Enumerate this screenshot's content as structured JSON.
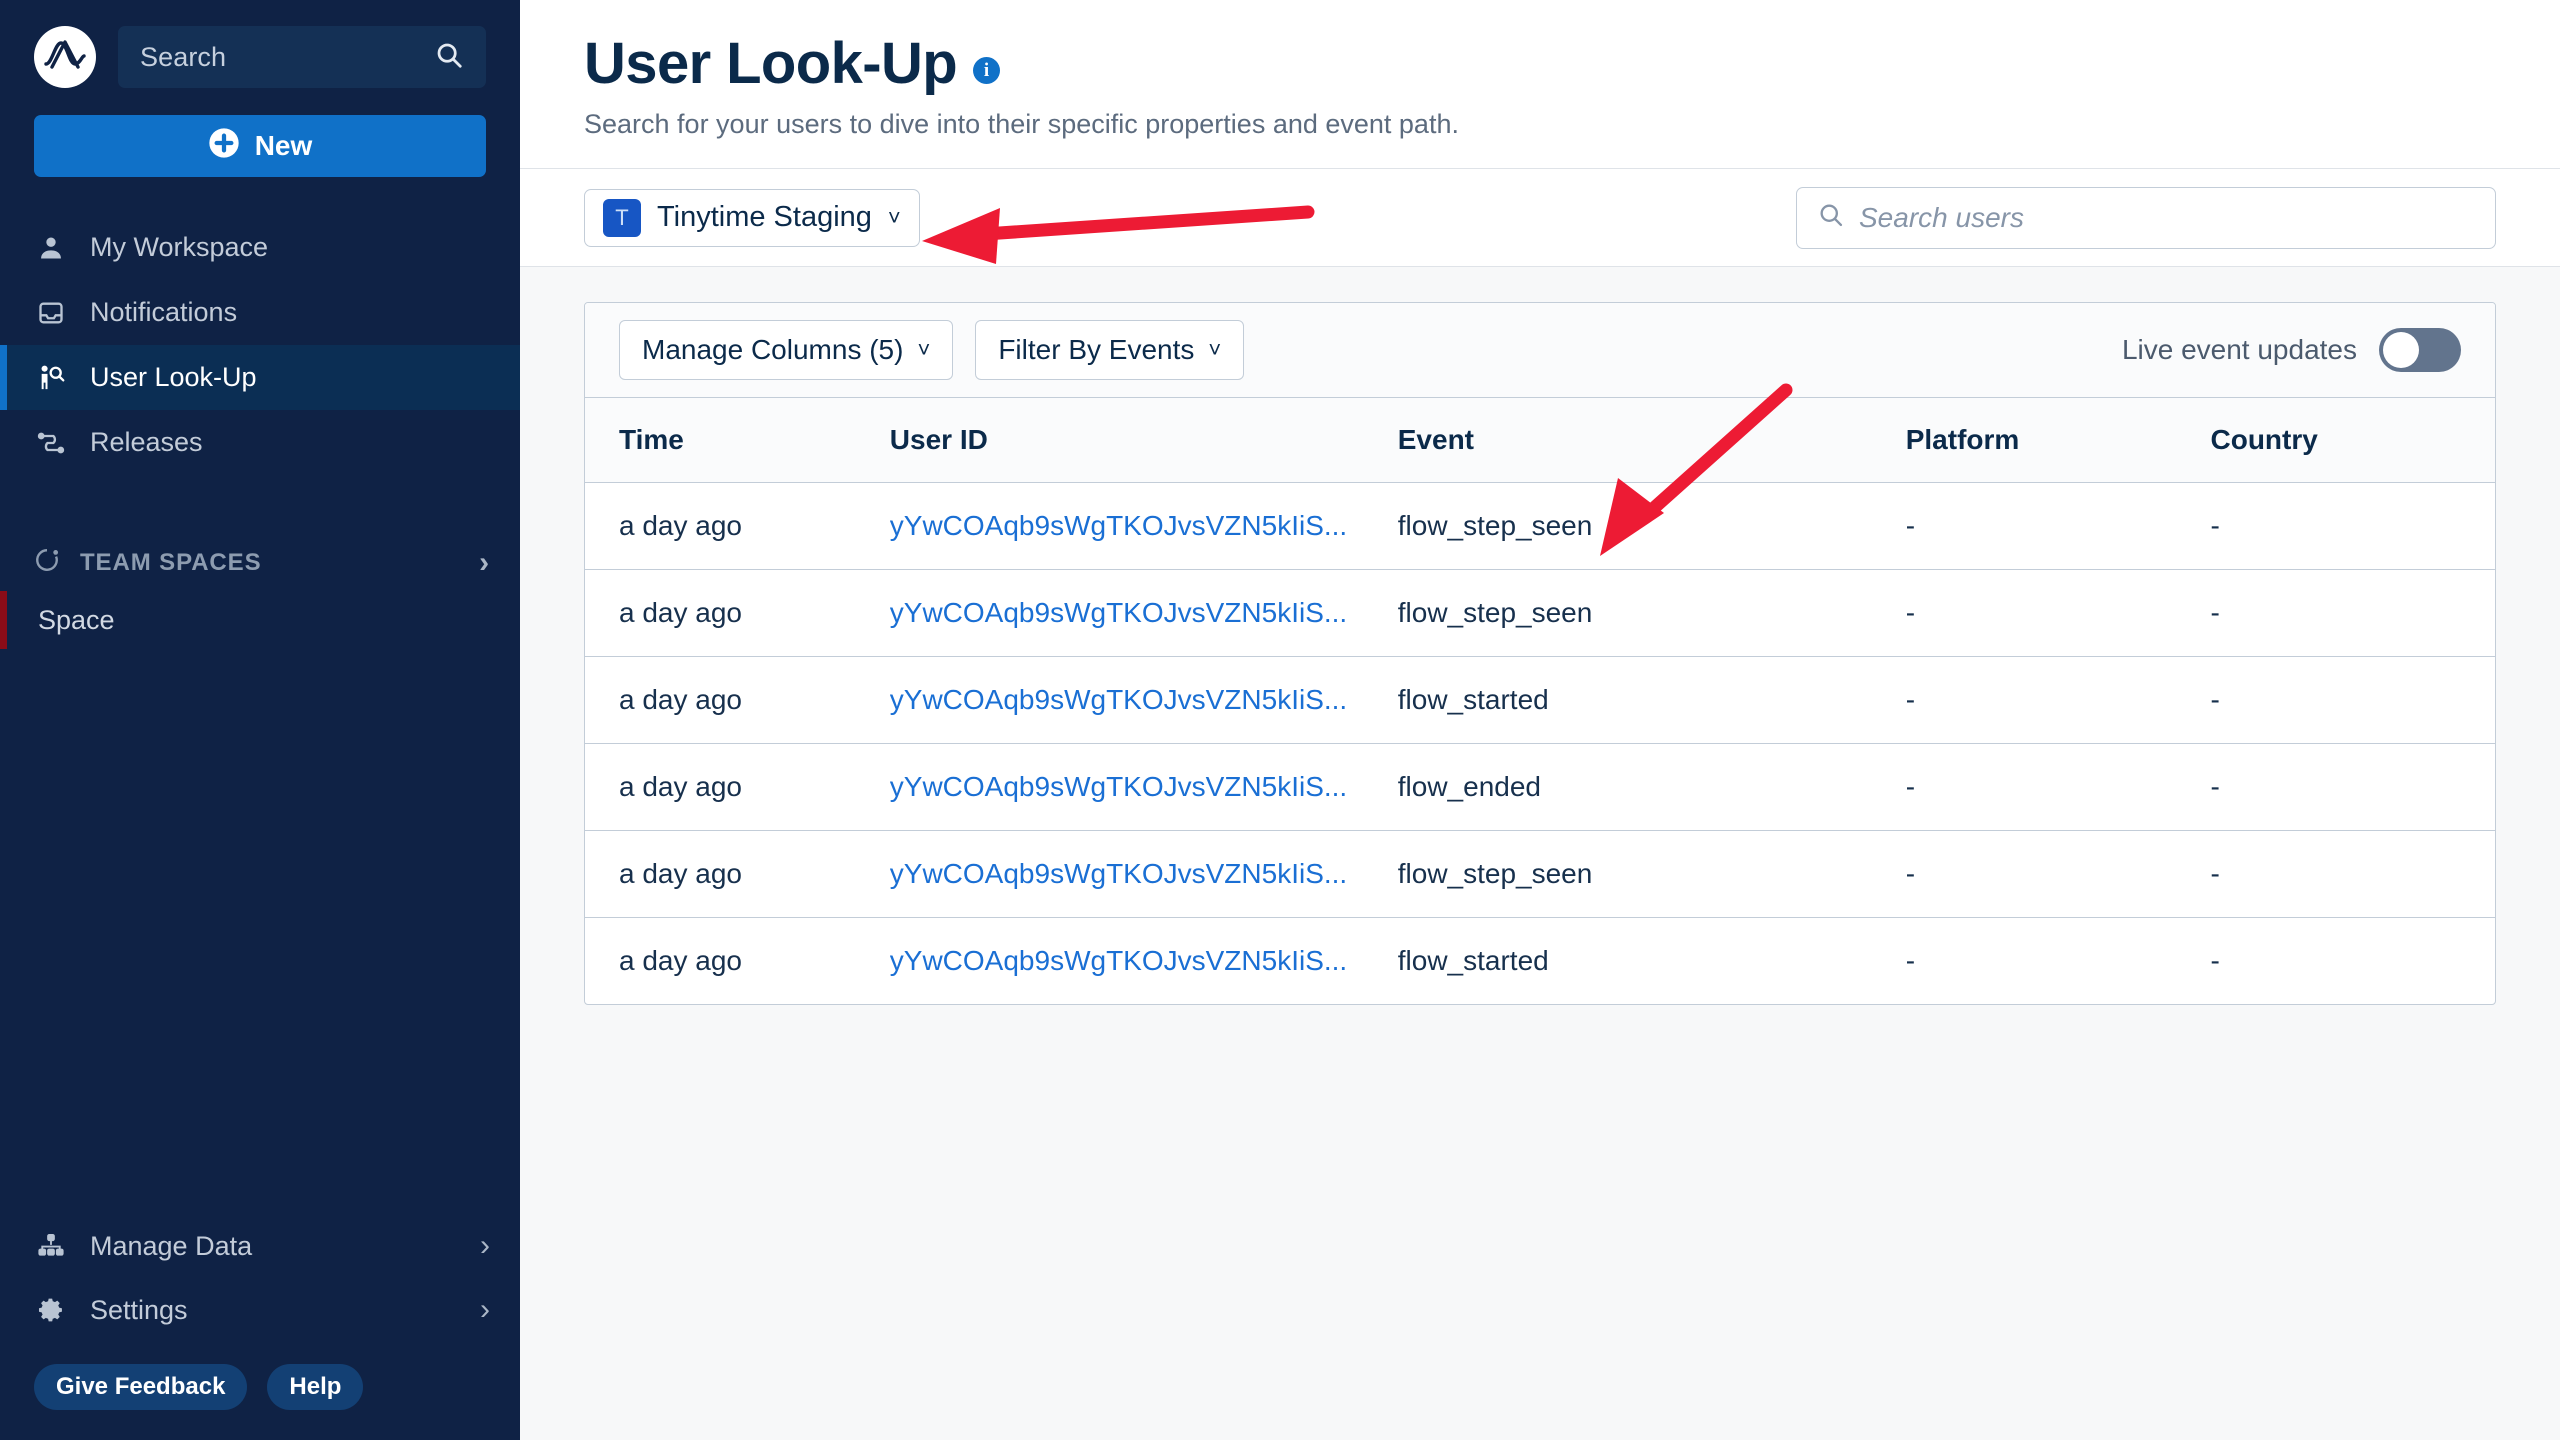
{
  "sidebar": {
    "logo_icon": "amplitude-logo-icon",
    "search": {
      "placeholder": "Search",
      "icon": "search-icon"
    },
    "new_button": {
      "label": "New",
      "icon": "plus-circle-icon"
    },
    "items": [
      {
        "label": "My Workspace",
        "icon": "person-icon",
        "active": false
      },
      {
        "label": "Notifications",
        "icon": "inbox-icon",
        "active": false
      },
      {
        "label": "User Look-Up",
        "icon": "person-search-icon",
        "active": true
      },
      {
        "label": "Releases",
        "icon": "releases-icon",
        "active": false
      }
    ],
    "team_spaces": {
      "label": "TEAM SPACES",
      "icon": "spaces-icon",
      "chevron": "chevron-right-icon"
    },
    "spaces": [
      {
        "label": "Space"
      }
    ],
    "bottom_items": [
      {
        "label": "Manage Data",
        "icon": "hierarchy-icon",
        "chevron": "chevron-right-icon"
      },
      {
        "label": "Settings",
        "icon": "gear-icon",
        "chevron": "chevron-right-icon"
      }
    ],
    "pills": [
      {
        "label": "Give Feedback"
      },
      {
        "label": "Help"
      }
    ]
  },
  "header": {
    "title": "User Look-Up",
    "info_icon": "info-icon",
    "info_glyph": "i",
    "subtitle": "Search for your users to dive into their specific properties and event path."
  },
  "filter_bar": {
    "project": {
      "badge": "T",
      "name": "Tinytime Staging",
      "caret": "chevron-down-icon"
    },
    "user_search": {
      "placeholder": "Search users",
      "value": "",
      "icon": "search-icon"
    }
  },
  "table": {
    "toolbar": {
      "manage_columns": {
        "label": "Manage Columns (5)",
        "caret": "chevron-down-icon"
      },
      "filter_by_events": {
        "label": "Filter By Events",
        "caret": "chevron-down-icon"
      },
      "live_updates": {
        "label": "Live event updates",
        "on": false
      }
    },
    "columns": [
      "Time",
      "User ID",
      "Event",
      "Platform",
      "Country"
    ],
    "rows": [
      {
        "time": "a day ago",
        "user_id": "yYwCOAqb9sWgTKOJvsVZN5kIiS...",
        "event": "flow_step_seen",
        "platform": "-",
        "country": "-"
      },
      {
        "time": "a day ago",
        "user_id": "yYwCOAqb9sWgTKOJvsVZN5kIiS...",
        "event": "flow_step_seen",
        "platform": "-",
        "country": "-"
      },
      {
        "time": "a day ago",
        "user_id": "yYwCOAqb9sWgTKOJvsVZN5kIiS...",
        "event": "flow_started",
        "platform": "-",
        "country": "-"
      },
      {
        "time": "a day ago",
        "user_id": "yYwCOAqb9sWgTKOJvsVZN5kIiS...",
        "event": "flow_ended",
        "platform": "-",
        "country": "-"
      },
      {
        "time": "a day ago",
        "user_id": "yYwCOAqb9sWgTKOJvsVZN5kIiS...",
        "event": "flow_step_seen",
        "platform": "-",
        "country": "-"
      },
      {
        "time": "a day ago",
        "user_id": "yYwCOAqb9sWgTKOJvsVZN5kIiS...",
        "event": "flow_started",
        "platform": "-",
        "country": "-"
      }
    ]
  },
  "annotations": {
    "arrow_color": "#ed1b34",
    "arrows": [
      {
        "name": "arrow-to-project-selector"
      },
      {
        "name": "arrow-to-event-cell"
      }
    ]
  },
  "colors": {
    "sidebar_bg": "#0f2245",
    "accent_blue": "#1071c8",
    "link_blue": "#1a6fd4",
    "title_navy": "#0b2a4a",
    "space_accent": "#8b0c18"
  }
}
